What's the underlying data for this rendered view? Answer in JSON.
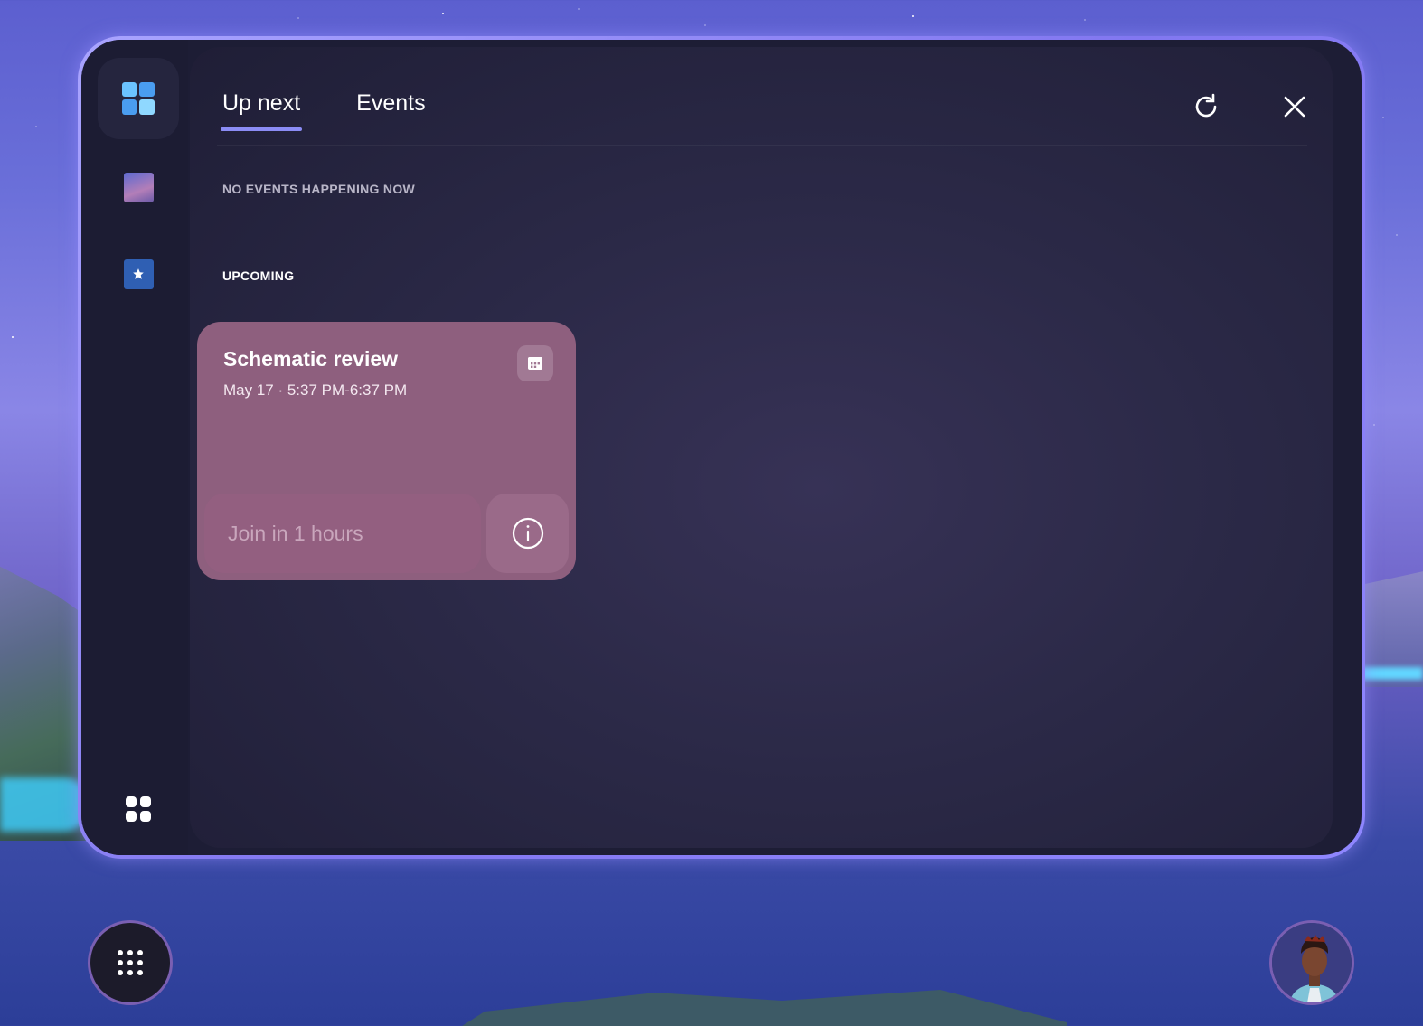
{
  "tabs": [
    {
      "label": "Up next",
      "active": true
    },
    {
      "label": "Events",
      "active": false
    }
  ],
  "sections": {
    "now_label": "NO EVENTS HAPPENING NOW",
    "upcoming_label": "UPCOMING"
  },
  "event": {
    "title": "Schematic review",
    "time": "May 17 · 5:37 PM-6:37 PM",
    "join_label": "Join in 1 hours"
  },
  "rail": {
    "items": [
      "mesh-logo-icon",
      "space-thumbnail-icon",
      "favorites-star-icon",
      "apps-grid-icon"
    ]
  },
  "colors": {
    "accent": "#8b8cf5",
    "card": "#8e5f7e",
    "panel": "#1d1d35"
  }
}
